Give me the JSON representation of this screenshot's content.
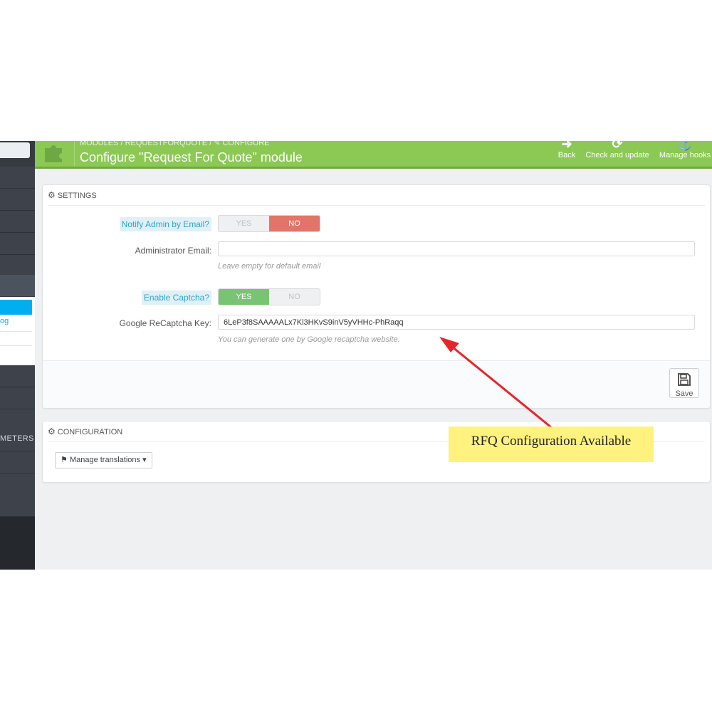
{
  "sidebar": {
    "submenu_link_fragment": "og",
    "section_label_fragment": "METERS"
  },
  "header": {
    "breadcrumb": "MODULES  /  REQUESTFORQUOTE  /  ✎ CONFIGURE",
    "title": "Configure \"Request For Quote\" module",
    "toolbar": [
      {
        "label": "Back",
        "icon": "back-icon"
      },
      {
        "label": "Check and update",
        "icon": "refresh-icon"
      },
      {
        "label": "Manage hooks",
        "icon": "anchor-icon"
      }
    ]
  },
  "settings": {
    "heading": "SETTINGS",
    "notify_label": "Notify Admin by Email?",
    "notify_yes": "YES",
    "notify_no": "NO",
    "notify_value": "NO",
    "admin_email_label": "Administrator Email:",
    "admin_email_value": "",
    "admin_email_help": "Leave empty for default email",
    "captcha_label": "Enable Captcha?",
    "captcha_yes": "YES",
    "captcha_no": "NO",
    "captcha_value": "YES",
    "recaptcha_label": "Google ReCaptcha Key:",
    "recaptcha_value": "6LeP3f8SAAAAALx7Kl3HKvS9inV5yVHHc-PhRaqq",
    "recaptcha_help": "You can generate one by Google recaptcha website.",
    "save_label": "Save"
  },
  "configuration": {
    "heading": "CONFIGURATION",
    "manage_translations_label": "Manage translations"
  },
  "annotation": {
    "callout_text": "RFQ Configuration Available",
    "arrow_color": "#e8242b"
  },
  "colors": {
    "header_green": "#8bc954",
    "toggle_red": "#e27469",
    "toggle_green": "#79c472",
    "sidebar_dark": "#363a41",
    "accent_blue": "#00aff0"
  }
}
